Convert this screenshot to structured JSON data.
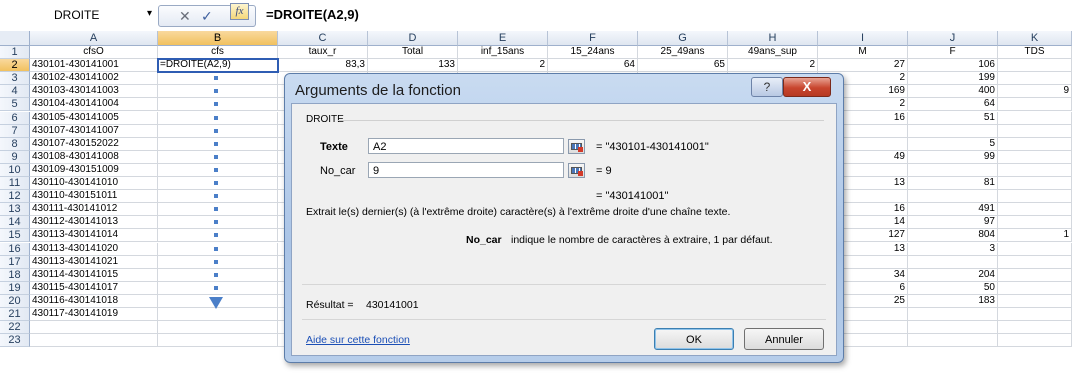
{
  "formula_bar": {
    "name_box": "DROITE",
    "name_arrow": "▾",
    "cancel_glyph": "✕",
    "enter_glyph": "✓",
    "fx_glyph": "fx",
    "formula": "=DROITE(A2,9)"
  },
  "columns": [
    "A",
    "B",
    "C",
    "D",
    "E",
    "F",
    "G",
    "H",
    "I",
    "J",
    "K"
  ],
  "header_row": {
    "A": "cfsO",
    "B": "cfs",
    "C": "taux_r",
    "D": "Total",
    "E": "inf_15ans",
    "F": "15_24ans",
    "G": "25_49ans",
    "H": "49ans_sup",
    "I": "M",
    "J": "F",
    "K": "TDS"
  },
  "rows": [
    {
      "num": "1"
    },
    {
      "num": "2",
      "A": "430101-430141001",
      "B": "=DROITE(A2,9)",
      "C": "83,3",
      "D": "133",
      "E": "2",
      "F": "64",
      "G": "65",
      "H": "2",
      "I": "27",
      "J": "106"
    },
    {
      "num": "3",
      "A": "430102-430141002",
      "I": "2",
      "J": "199"
    },
    {
      "num": "4",
      "A": "430103-430141003",
      "I": "169",
      "J": "400",
      "K": "9"
    },
    {
      "num": "5",
      "A": "430104-430141004",
      "I": "2",
      "J": "64"
    },
    {
      "num": "6",
      "A": "430105-430141005",
      "I": "16",
      "J": "51"
    },
    {
      "num": "7",
      "A": "430107-430141007"
    },
    {
      "num": "8",
      "A": "430107-430152022",
      "J": "5"
    },
    {
      "num": "9",
      "A": "430108-430141008",
      "I": "49",
      "J": "99"
    },
    {
      "num": "10",
      "A": "430109-430151009"
    },
    {
      "num": "11",
      "A": "430110-430141010",
      "I": "13",
      "J": "81"
    },
    {
      "num": "12",
      "A": "430110-430151011"
    },
    {
      "num": "13",
      "A": "430111-430141012",
      "I": "16",
      "J": "491"
    },
    {
      "num": "14",
      "A": "430112-430141013",
      "I": "14",
      "J": "97"
    },
    {
      "num": "15",
      "A": "430113-430141014",
      "I": "127",
      "J": "804",
      "K": "1"
    },
    {
      "num": "16",
      "A": "430113-430141020",
      "I": "13",
      "J": "3"
    },
    {
      "num": "17",
      "A": "430113-430141021"
    },
    {
      "num": "18",
      "A": "430114-430141015",
      "I": "34",
      "J": "204"
    },
    {
      "num": "19",
      "A": "430115-430141017",
      "I": "6",
      "J": "50"
    },
    {
      "num": "20",
      "A": "430116-430141018",
      "I": "25",
      "J": "183"
    },
    {
      "num": "21",
      "A": "430117-430141019",
      "C": "??"
    },
    {
      "num": "22"
    },
    {
      "num": "23"
    }
  ],
  "dialog": {
    "title": "Arguments de la fonction",
    "help_glyph": "?",
    "close_glyph": "X",
    "group_label": "DROITE",
    "arg1_label": "Texte",
    "arg1_value": "A2",
    "arg1_result": "=  \"430101-430141001\"",
    "arg2_label": "No_car",
    "arg2_value": "9",
    "arg2_result": "=  9",
    "func_result": "=  \"430141001\"",
    "description": "Extrait le(s) dernier(s) (à l'extrême droite) caractère(s) à l'extrême droite d'une chaîne texte.",
    "arg_help_name": "No_car",
    "arg_help_text": "indique le nombre de caractères à extraire, 1 par défaut.",
    "result_label": "Résultat =",
    "result_value": "430141001",
    "help_link": "Aide sur cette fonction",
    "ok_label": "OK",
    "cancel_label": "Annuler"
  },
  "colors": {
    "selection": "#2f5db3",
    "header_highlight": "#f1c15f",
    "link": "#1b4fb6"
  }
}
